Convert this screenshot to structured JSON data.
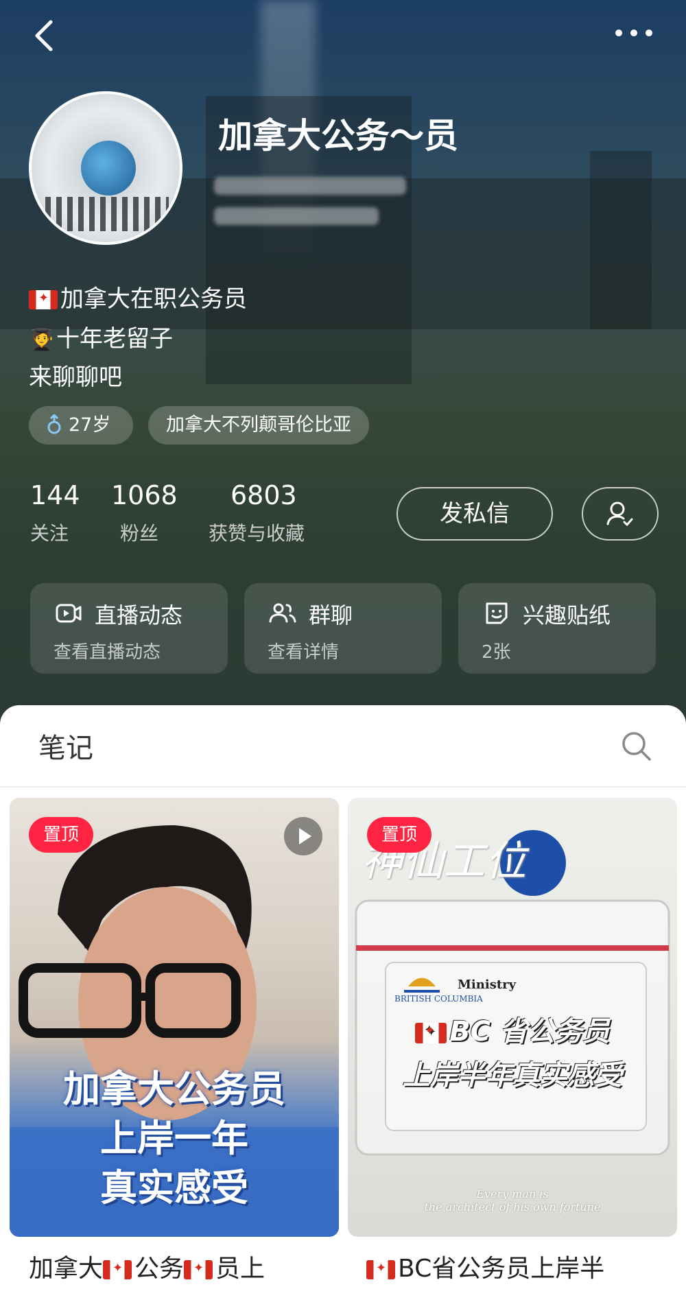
{
  "profile": {
    "username": "加拿大公务～员",
    "bio": [
      "加拿大在职公务员",
      "十年老留子",
      "来聊聊吧"
    ],
    "tags": [
      "27岁",
      "加拿大不列颠哥伦比亚"
    ],
    "stats": [
      {
        "value": "144",
        "label": "关注"
      },
      {
        "value": "1068",
        "label": "粉丝"
      },
      {
        "value": "6803",
        "label": "获赞与收藏"
      }
    ],
    "message_button": "发私信"
  },
  "cards": [
    {
      "title": "直播动态",
      "subtitle": "查看直播动态",
      "icon": "live-camera-icon"
    },
    {
      "title": "群聊",
      "subtitle": "查看详情",
      "icon": "group-icon"
    },
    {
      "title": "兴趣贴纸",
      "subtitle": "2张",
      "icon": "sticker-icon"
    }
  ],
  "notes": {
    "tab_title": "笔记",
    "items": [
      {
        "pin_label": "置顶",
        "overlay_lines": [
          "加拿大公务员",
          "上岸一年",
          "真实感受"
        ],
        "title_parts": [
          "加拿大",
          "公务",
          "员上"
        ]
      },
      {
        "pin_label": "置顶",
        "overlay_lines": [
          "BC 省公务员",
          "上岸半年真实感受"
        ],
        "handwriting": "神仙工位",
        "badge_text": "Ministry",
        "badge_logo": "BRITISH COLUMBIA",
        "quote": [
          "Every man is",
          "the architect of his own fortune"
        ],
        "title": "BC省公务员上岸半"
      }
    ]
  },
  "colors": {
    "accent": "#ff2442",
    "hero_bg": "#2b3a33"
  }
}
